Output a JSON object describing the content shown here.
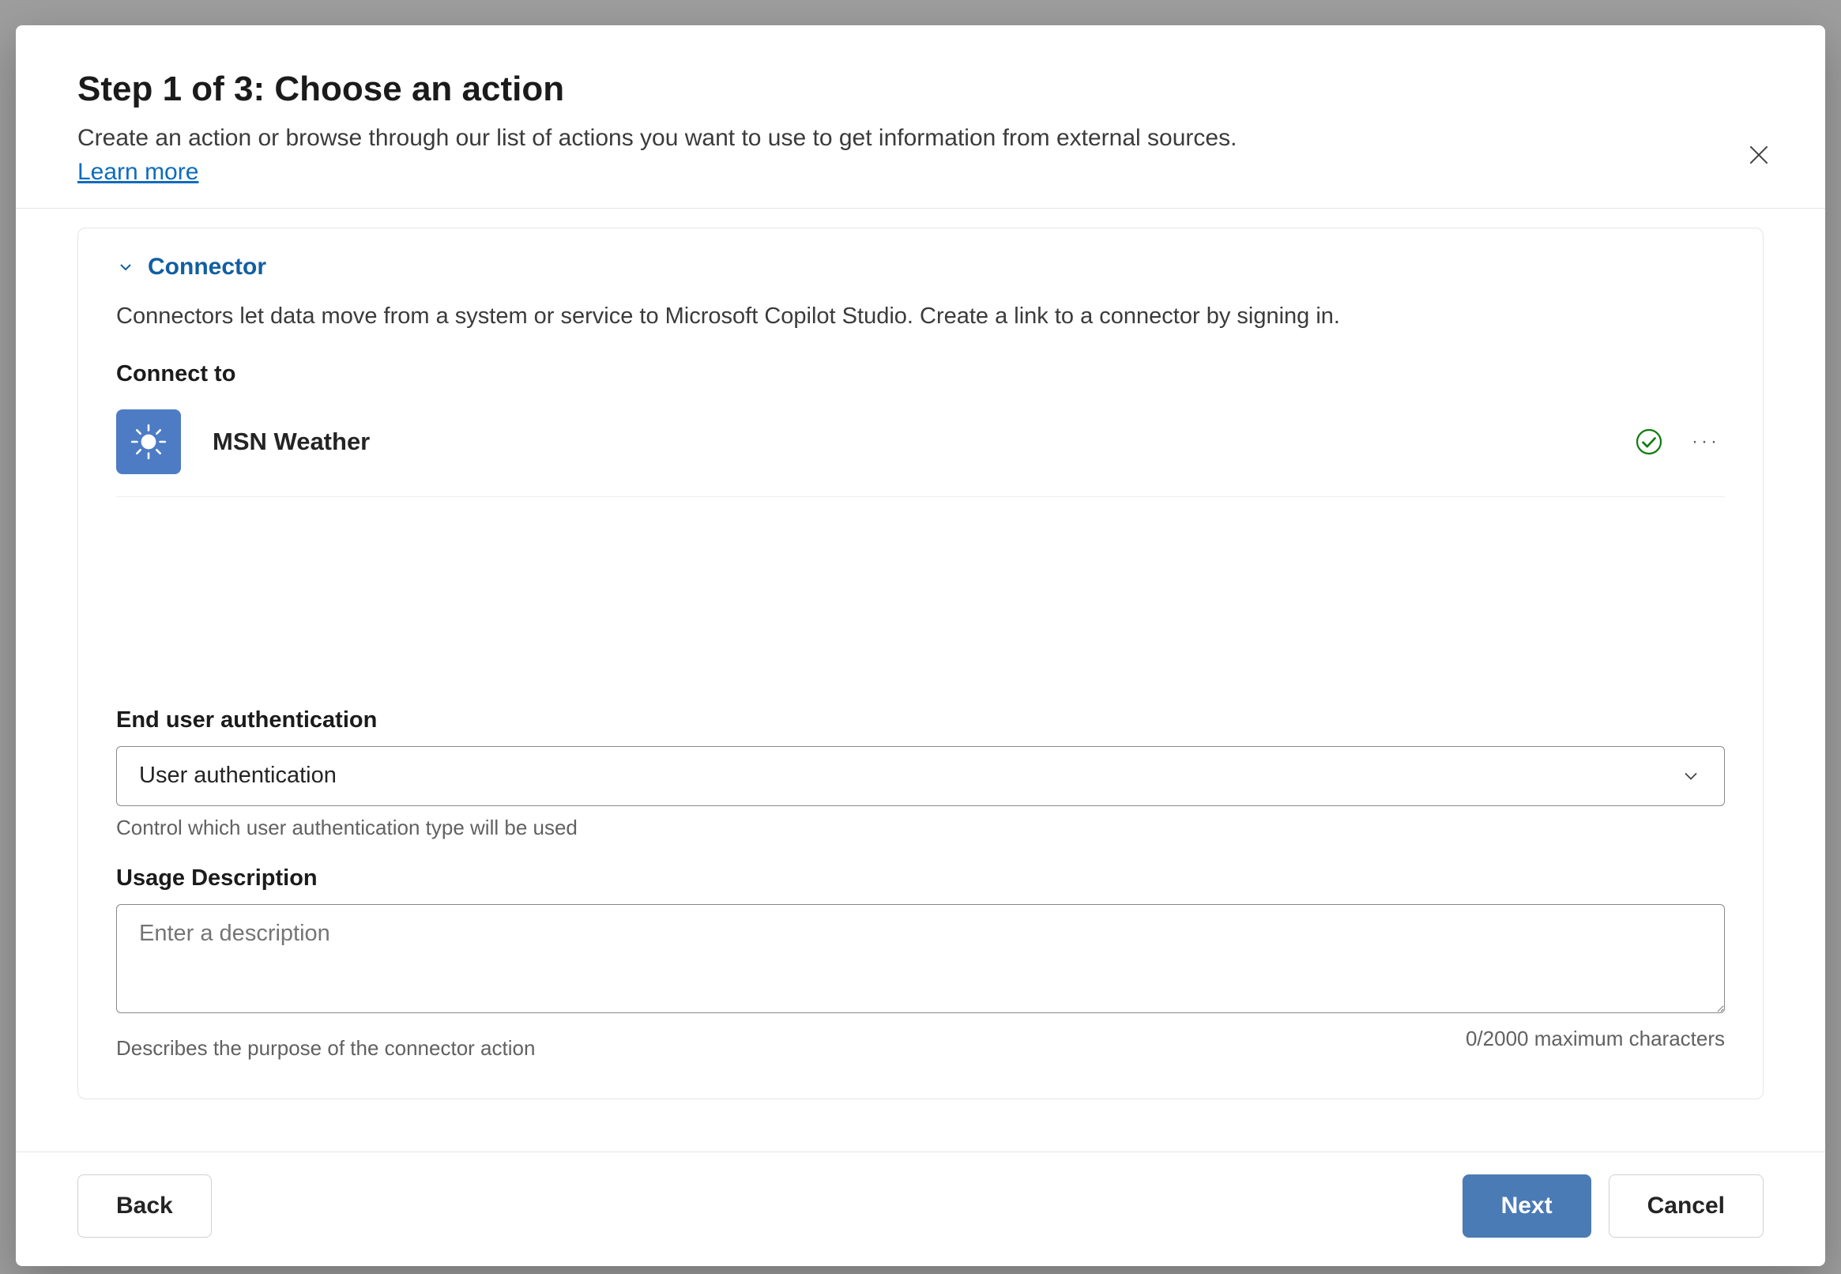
{
  "header": {
    "title": "Step 1 of 3: Choose an action",
    "subtitle": "Create an action or browse through our list of actions you want to use to get information from external sources.",
    "learnMore": "Learn more"
  },
  "connector": {
    "sectionLabel": "Connector",
    "description": "Connectors let data move from a system or service to Microsoft Copilot Studio. Create a link to a connector by signing in.",
    "connectToLabel": "Connect to",
    "item": {
      "name": "MSN Weather"
    }
  },
  "authField": {
    "label": "End user authentication",
    "value": "User authentication",
    "helper": "Control which user authentication type will be used"
  },
  "descField": {
    "label": "Usage Description",
    "placeholder": "Enter a description",
    "helper": "Describes the purpose of the connector action",
    "charCount": "0/2000 maximum characters"
  },
  "footer": {
    "back": "Back",
    "next": "Next",
    "cancel": "Cancel"
  }
}
